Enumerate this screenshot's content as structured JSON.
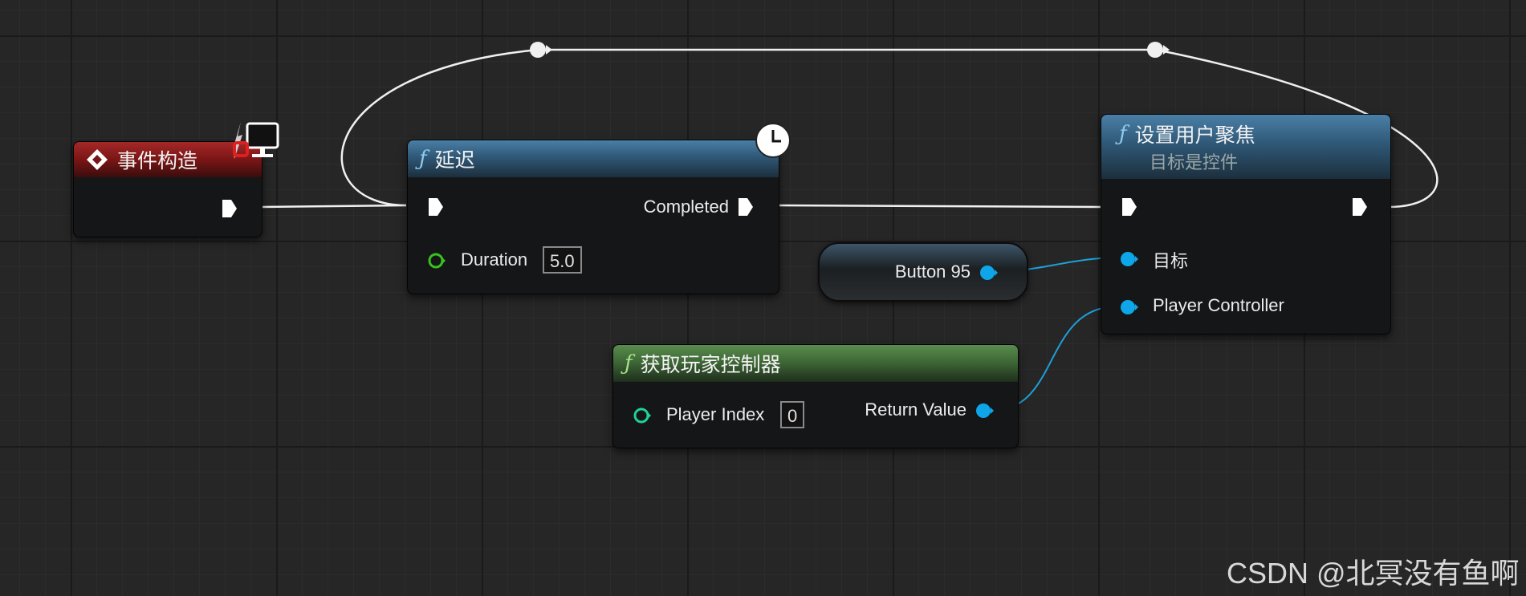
{
  "nodes": {
    "event": {
      "title": "事件构造"
    },
    "delay": {
      "title": "延迟",
      "func_glyph": "ƒ",
      "completed_label": "Completed",
      "duration_label": "Duration",
      "duration_value": "5.0"
    },
    "set_focus": {
      "title": "设置用户聚焦",
      "subtitle": "目标是控件",
      "func_glyph": "ƒ",
      "target_label": "目标",
      "player_controller_label": "Player Controller"
    },
    "button_var": {
      "label": "Button 95"
    },
    "get_player_controller": {
      "title": "获取玩家控制器",
      "func_glyph": "ƒ",
      "player_index_label": "Player Index",
      "player_index_value": "0",
      "return_value_label": "Return Value"
    }
  },
  "watermark": "CSDN @北冥没有鱼啊",
  "colors": {
    "exec_wire": "#f0f0f0",
    "object_wire": "#1da0d8",
    "object_pin": "#0ea5e9",
    "int_pin": "#1fd19a",
    "float_pin": "#38c21b",
    "event_header": "#8b1a1a",
    "function_header": "#3a6b8f",
    "pure_function_header": "#4a7a40"
  },
  "icons": [
    "event-diamond-icon",
    "client-monitor-icon",
    "latent-clock-icon",
    "function-icon",
    "reroute-knot-icon"
  ]
}
